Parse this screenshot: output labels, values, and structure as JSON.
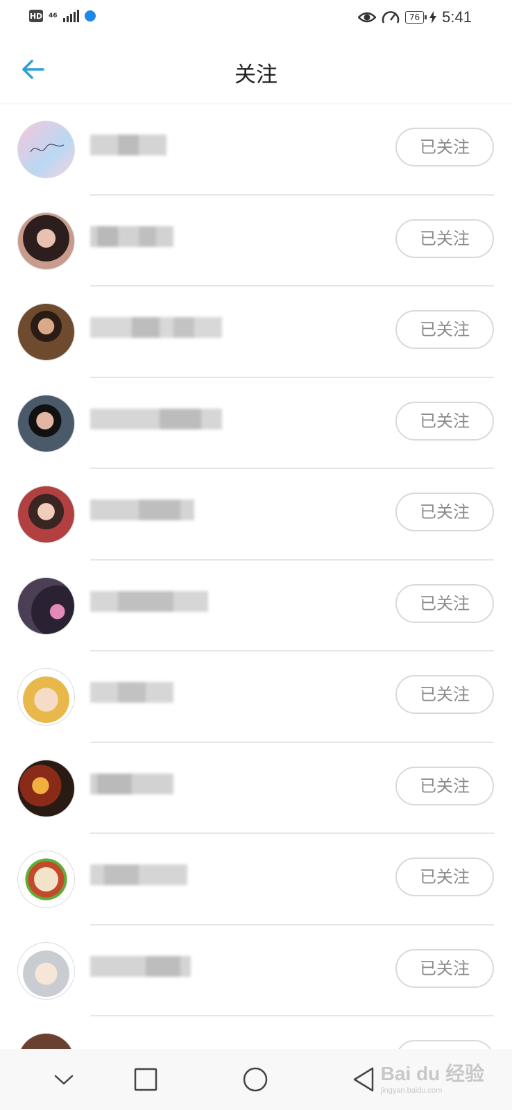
{
  "status_bar": {
    "hd": "HD",
    "network": "46",
    "battery": "76",
    "time": "5:41"
  },
  "header": {
    "title": "关注",
    "back_icon": "arrow-left-icon",
    "accent_color": "#2a9fd8"
  },
  "follow_list": {
    "button_label": "已关注",
    "items": [
      {
        "avatar": "avatar-pink-signature"
      },
      {
        "avatar": "avatar-girl-photo"
      },
      {
        "avatar": "avatar-man-eating"
      },
      {
        "avatar": "avatar-boy-photo"
      },
      {
        "avatar": "avatar-woman-red"
      },
      {
        "avatar": "avatar-dark-selfie"
      },
      {
        "avatar": "avatar-cartoon-blonde"
      },
      {
        "avatar": "avatar-anime-naruto"
      },
      {
        "avatar": "avatar-logo-sign"
      },
      {
        "avatar": "avatar-anime-glasses"
      }
    ]
  },
  "nav_bar": {
    "icons": [
      "chevron-down-icon",
      "square-icon",
      "circle-icon",
      "back-triangle-icon"
    ]
  },
  "watermark": {
    "text": "Bai du 经验",
    "sub": "jingyan.baidu.com"
  }
}
